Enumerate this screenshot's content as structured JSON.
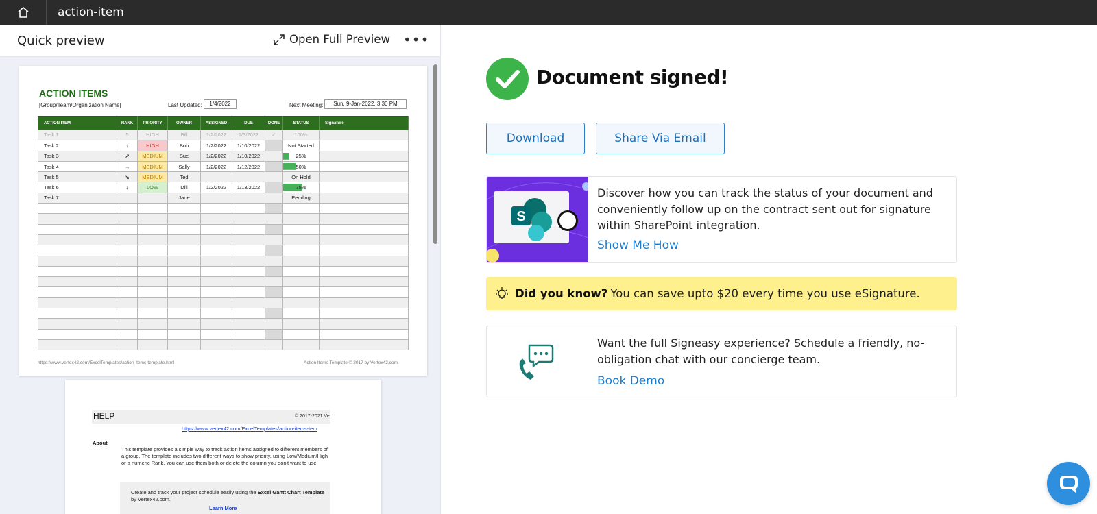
{
  "topbar": {
    "title": "action-item"
  },
  "preview": {
    "heading": "Quick preview",
    "open_full": "Open Full Preview",
    "more": "•••",
    "page1": {
      "title": "ACTION ITEMS",
      "group": "[Group/Team/Organization Name]",
      "last_updated_label": "Last Updated:",
      "last_updated": "1/4/2022",
      "next_meeting_label": "Next Meeting:",
      "next_meeting": "Sun, 9-Jan-2022, 3:30 PM",
      "columns": [
        "ACTION ITEM",
        "RANK",
        "PRIORITY",
        "OWNER",
        "ASSIGNED",
        "DUE",
        "DONE",
        "STATUS",
        "Signature"
      ],
      "rows": [
        {
          "item": "Task 1",
          "rank": "5",
          "priority": "HIGH",
          "owner": "Bill",
          "assigned": "1/2/2022",
          "due": "1/3/2022",
          "done": "✓",
          "status": "100%"
        },
        {
          "item": "Task 2",
          "rank": "↑",
          "priority": "HIGH",
          "owner": "Bob",
          "assigned": "1/2/2022",
          "due": "1/10/2022",
          "done": "",
          "status": "Not Started"
        },
        {
          "item": "Task 3",
          "rank": "↗",
          "priority": "MEDIUM",
          "owner": "Sue",
          "assigned": "1/2/2022",
          "due": "1/10/2022",
          "done": "",
          "status": "25%"
        },
        {
          "item": "Task 4",
          "rank": "→",
          "priority": "MEDIUM",
          "owner": "Sally",
          "assigned": "1/2/2022",
          "due": "1/12/2022",
          "done": "",
          "status": "50%"
        },
        {
          "item": "Task 5",
          "rank": "↘",
          "priority": "MEDIUM",
          "owner": "Ted",
          "assigned": "",
          "due": "",
          "done": "",
          "status": "On Hold"
        },
        {
          "item": "Task 6",
          "rank": "↓",
          "priority": "LOW",
          "owner": "Dill",
          "assigned": "1/2/2022",
          "due": "1/13/2022",
          "done": "",
          "status": "75%"
        },
        {
          "item": "Task 7",
          "rank": "",
          "priority": "",
          "owner": "Jane",
          "assigned": "",
          "due": "",
          "done": "",
          "status": "Pending"
        }
      ],
      "footer_left": "https://www.vertex42.com/ExcelTemplates/action-items-template.html",
      "footer_right": "Action Items Template © 2017 by Vertex42.com"
    },
    "page2": {
      "title": "HELP",
      "copyright": "© 2017-2021 Ver",
      "link": "https://www.vertex42.com/ExcelTemplates/action-items-tem",
      "about_heading": "About",
      "about_text": "This template provides a simple way to track action items assigned to different members of a group. The template includes two different ways to show priority, using Low/Medium/High or a numeric Rank. You can use them both or delete the column you don't want to use.",
      "gantt_pre": "Create and track your project schedule easily using the ",
      "gantt_bold": "Excel Gantt Chart Template",
      "gantt_post": " by Vertex42.com.",
      "learn_more": "Learn More"
    }
  },
  "main": {
    "signed_heading": "Document signed!",
    "download_label": "Download",
    "share_label": "Share Via Email",
    "sharepoint": {
      "text": "Discover how you can track the status of your document and conveniently follow up on the contract sent out for signature within SharePoint integration.",
      "link": "Show Me How"
    },
    "tip": {
      "bold": "Did you know?",
      "text": "You can save upto $20 every time you use eSignature."
    },
    "demo": {
      "text": "Want the full Signeasy experience? Schedule a friendly, no-obligation chat with our concierge team.",
      "link": "Book Demo"
    }
  },
  "colors": {
    "accent": "#1f7bc9",
    "success": "#3cb44a",
    "tip_bg": "#fdf08d",
    "topbar": "#2b2b2b",
    "sharepoint_purple": "#6c2fe0"
  },
  "icons": [
    "home-icon",
    "expand-icon",
    "more-icon",
    "check-circle-icon",
    "sharepoint-icon",
    "lightbulb-icon",
    "phone-chat-icon",
    "chat-icon"
  ]
}
